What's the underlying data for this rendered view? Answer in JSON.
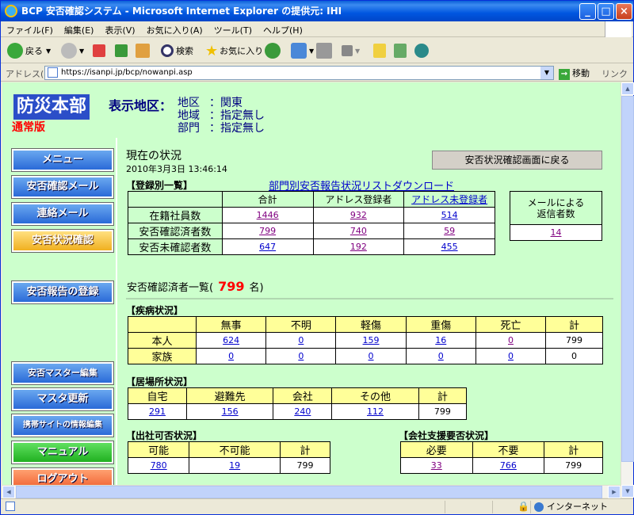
{
  "window": {
    "title": "BCP 安否確認システム - Microsoft Internet Explorer の提供元: IHI"
  },
  "menu": [
    "ファイル(F)",
    "編集(E)",
    "表示(V)",
    "お気に入り(A)",
    "ツール(T)",
    "ヘルプ(H)"
  ],
  "toolbar": {
    "back": "戻る",
    "search": "検索",
    "favorites": "お気に入り"
  },
  "address": {
    "label": "アドレス(D)",
    "url": "https://isanpi.jp/bcp/nowanpi.asp",
    "go": "移動",
    "links": "リンク"
  },
  "status": {
    "zone": "インターネット"
  },
  "header": {
    "title": "防災本部",
    "mode": "通常版",
    "area_label": "表示地区：",
    "lines": [
      {
        "key": "地区",
        "value": "：関東"
      },
      {
        "key": "地域",
        "value": "：指定無し"
      },
      {
        "key": "部門",
        "value": "：指定無し"
      }
    ]
  },
  "sidebar": [
    "メニュー",
    "安否確認メール",
    "連絡メール",
    "安否状況確認",
    "安否報告の登録",
    "安否マスター編集",
    "マスタ更新",
    "携帯サイトの情報編集",
    "マニュアル",
    "ログアウト"
  ],
  "main": {
    "now_title": "現在の状況",
    "now_date": "2010年3月3日  13:46:14",
    "back_button": "安否状況確認画面に戻る",
    "reg_label": "【登録別一覧】",
    "dept_link": "部門別安否報告状況リストダウンロード",
    "reg_table": {
      "headers": [
        "合計",
        "アドレス登録者",
        "アドレス未登録者"
      ],
      "rows": [
        {
          "label": "在籍社員数",
          "values": [
            "1446",
            "932",
            "514"
          ]
        },
        {
          "label": "安否確認済者数",
          "values": [
            "799",
            "740",
            "59"
          ]
        },
        {
          "label": "安否未確認者数",
          "values": [
            "647",
            "192",
            "455"
          ]
        }
      ]
    },
    "mail_table": {
      "header": "メールによる\n返信者数",
      "value": "14"
    },
    "list_prefix": "安否確認済者一覧(",
    "list_count": "799",
    "list_suffix": "名)",
    "illness_label": "【疾病状況】",
    "illness_table": {
      "headers": [
        "無事",
        "不明",
        "軽傷",
        "重傷",
        "死亡",
        "計"
      ],
      "rows": [
        {
          "label": "本人",
          "values": [
            "624",
            "0",
            "159",
            "16",
            "0",
            "799"
          ]
        },
        {
          "label": "家族",
          "values": [
            "0",
            "0",
            "0",
            "0",
            "0",
            "0"
          ]
        }
      ]
    },
    "residence_label": "【居場所状況】",
    "residence_table": {
      "headers": [
        "自宅",
        "避難先",
        "会社",
        "その他",
        "計"
      ],
      "values": [
        "291",
        "156",
        "240",
        "112",
        "799"
      ]
    },
    "attend_label": "【出社可否状況】",
    "attend_table": {
      "headers": [
        "可能",
        "不可能",
        "計"
      ],
      "values": [
        "780",
        "19",
        "799"
      ]
    },
    "support_label": "【会社支援要否状況】",
    "support_table": {
      "headers": [
        "必要",
        "不要",
        "計"
      ],
      "values": [
        "33",
        "766",
        "799"
      ]
    }
  }
}
